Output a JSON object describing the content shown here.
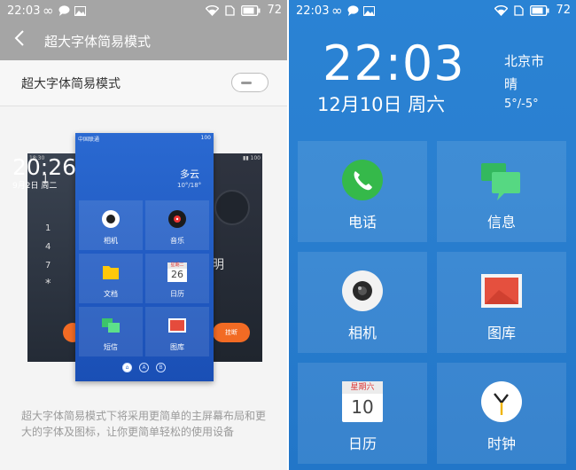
{
  "status_bar": {
    "time": "22:03",
    "battery": "72"
  },
  "left": {
    "header_title": "超大字体简易模式",
    "setting_label": "超大字体简易模式",
    "toggle_on": false,
    "preview": {
      "left_status_time": "18:30",
      "dial_keys": [
        "1",
        "4",
        "7",
        "*"
      ],
      "right_big_char": "明",
      "right_pill": "挂断",
      "carrier": "中国联通",
      "battery": "100",
      "time": "20:26",
      "date": "9月2日 周二",
      "weather": "多云",
      "temp": "10°/18°",
      "apps": [
        {
          "label": "相机",
          "icon": "camera-icon"
        },
        {
          "label": "音乐",
          "icon": "music-icon"
        },
        {
          "label": "文档",
          "icon": "folder-icon"
        },
        {
          "label": "日历",
          "icon": "calendar-icon",
          "cal_weekday": "星期二",
          "cal_day": "26"
        },
        {
          "label": "短信",
          "icon": "message-icon"
        },
        {
          "label": "图库",
          "icon": "gallery-icon"
        }
      ],
      "dots": [
        "⌂",
        "A",
        "B"
      ]
    },
    "description": "超大字体简易模式下将采用更简单的主屏幕布局和更大的字体及图标，让你更简单轻松的使用设备"
  },
  "right": {
    "clock": "22:03",
    "date": "12月10日 周六",
    "city": "北京市",
    "weather": "晴",
    "temp": "5°/-5°",
    "apps": [
      {
        "label": "电话",
        "icon": "phone-icon"
      },
      {
        "label": "信息",
        "icon": "message-icon"
      },
      {
        "label": "相机",
        "icon": "camera-icon"
      },
      {
        "label": "图库",
        "icon": "gallery-icon"
      },
      {
        "label": "日历",
        "icon": "calendar-icon",
        "cal_weekday": "星期六",
        "cal_day": "10"
      },
      {
        "label": "时钟",
        "icon": "clock-icon"
      }
    ]
  },
  "colors": {
    "accent_blue": "#2a7fd0",
    "header_gray": "#a5a5a5",
    "orange": "#f26b24",
    "phone_green": "#35b94a"
  }
}
